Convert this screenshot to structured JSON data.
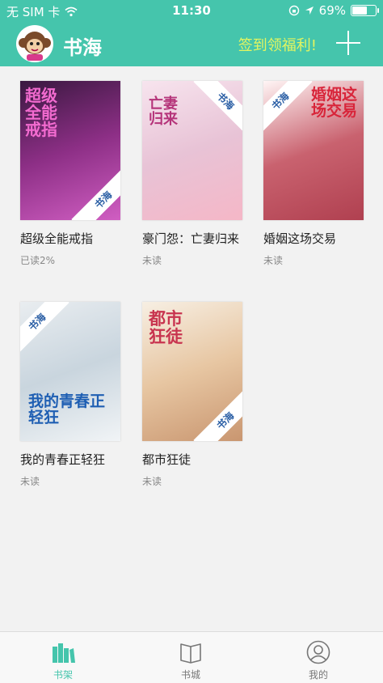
{
  "status_bar": {
    "carrier": "无 SIM 卡",
    "time": "11:30",
    "battery_pct": "69%",
    "battery_level": 0.69
  },
  "nav": {
    "title": "书海",
    "checkin": "签到领福利!"
  },
  "books": [
    {
      "title": "超级全能戒指",
      "progress": "已读2%",
      "cover_text": "超级全能戒指",
      "ribbon": "书海",
      "colors": [
        "#3a1840",
        "#8d2f86",
        "#d05ec2"
      ]
    },
    {
      "title": "豪门怨：亡妻归来",
      "progress": "未读",
      "cover_text": "亡妻归来",
      "ribbon": "书海",
      "colors": [
        "#f7e4ee",
        "#e8c3d6",
        "#f5b7c7"
      ]
    },
    {
      "title": "婚姻这场交易",
      "progress": "未读",
      "cover_text": "婚姻这场交易",
      "ribbon": "书海",
      "colors": [
        "#fff5f5",
        "#c9626f",
        "#b04050"
      ]
    },
    {
      "title": "我的青春正轻狂",
      "progress": "未读",
      "cover_text": "我的青春正轻狂",
      "ribbon": "书海",
      "colors": [
        "#e9edf0",
        "#c9d5de",
        "#f1f4f6"
      ]
    },
    {
      "title": "都市狂徒",
      "progress": "未读",
      "cover_text": "都市狂徒",
      "ribbon": "书海",
      "colors": [
        "#f7efe3",
        "#e7c6a2",
        "#c99670"
      ]
    }
  ],
  "tabs": [
    {
      "label": "书架",
      "icon": "bookshelf-icon",
      "active": true
    },
    {
      "label": "书城",
      "icon": "book-open-icon",
      "active": false
    },
    {
      "label": "我的",
      "icon": "user-icon",
      "active": false
    }
  ],
  "colors": {
    "brand": "#45c5ac",
    "checkin": "#e3f560"
  }
}
